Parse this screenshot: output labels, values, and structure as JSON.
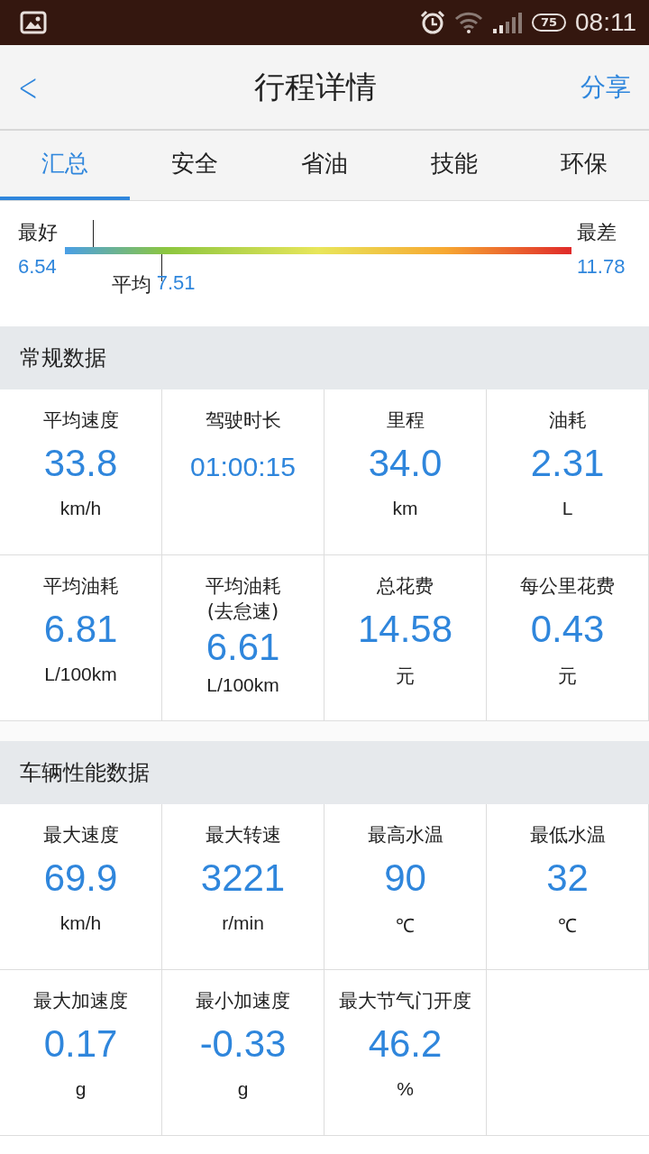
{
  "status_bar": {
    "time": "08:11",
    "battery": "75"
  },
  "header": {
    "back": "<",
    "title": "行程详情",
    "action": "分享"
  },
  "tabs": [
    {
      "label": "汇总",
      "selected": true
    },
    {
      "label": "安全",
      "selected": false
    },
    {
      "label": "省油",
      "selected": false
    },
    {
      "label": "技能",
      "selected": false
    },
    {
      "label": "环保",
      "selected": false
    }
  ],
  "scale": {
    "best_label": "最好",
    "best_value": "6.54",
    "worst_label": "最差",
    "worst_value": "11.78",
    "trip_marker": {
      "level": 0.055
    },
    "average": {
      "label": "平均",
      "value": "7.51",
      "level": 0.19
    }
  },
  "sections": [
    {
      "title": "常规数据",
      "cells": [
        {
          "label": "平均速度",
          "value": "33.8",
          "unit": "km/h"
        },
        {
          "label": "驾驶时长",
          "value": "01:00:15",
          "small": true
        },
        {
          "label": "里程",
          "value": "34.0",
          "unit": "km"
        },
        {
          "label": "油耗",
          "value": "2.31",
          "unit": "L"
        },
        {
          "label": "平均油耗",
          "value": "6.81",
          "unit": "L/100km"
        },
        {
          "label": "平均油耗",
          "sublabel": "(去怠速)",
          "value": "6.61",
          "unit": "L/100km"
        },
        {
          "label": "总花费",
          "value": "14.58",
          "unit": "元"
        },
        {
          "label": "每公里花费",
          "value": "0.43",
          "unit": "元"
        }
      ]
    },
    {
      "title": "车辆性能数据",
      "cells": [
        {
          "label": "最大速度",
          "value": "69.9",
          "unit": "km/h"
        },
        {
          "label": "最大转速",
          "value": "3221",
          "unit": "r/min"
        },
        {
          "label": "最高水温",
          "value": "90",
          "unit": "℃"
        },
        {
          "label": "最低水温",
          "value": "32",
          "unit": "℃"
        },
        {
          "label": "最大加速度",
          "value": "0.17",
          "unit": "g"
        },
        {
          "label": "最小加速度",
          "value": "-0.33",
          "unit": "g"
        },
        {
          "label": "最大节气门开度",
          "value": "46.2",
          "unit": "%"
        }
      ]
    }
  ]
}
